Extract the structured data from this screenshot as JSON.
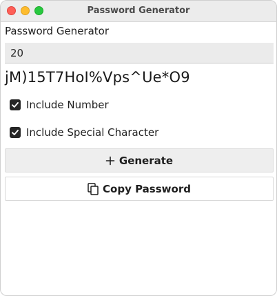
{
  "window": {
    "title": "Password Generator"
  },
  "app": {
    "label": "Password Generator",
    "length_value": "20",
    "password": "jM)15T7HoI%Vps^Ue*O9"
  },
  "options": {
    "include_number": {
      "label": "Include Number",
      "checked": true
    },
    "include_special": {
      "label": "Include Special Character",
      "checked": true
    }
  },
  "buttons": {
    "generate": {
      "label": "Generate",
      "icon": "plus-icon"
    },
    "copy": {
      "label": "Copy Password",
      "icon": "copy-icon"
    }
  },
  "colors": {
    "close": "#fe5f57",
    "minimize": "#febc2e",
    "maximize": "#28c840",
    "checkbox": "#262626"
  }
}
